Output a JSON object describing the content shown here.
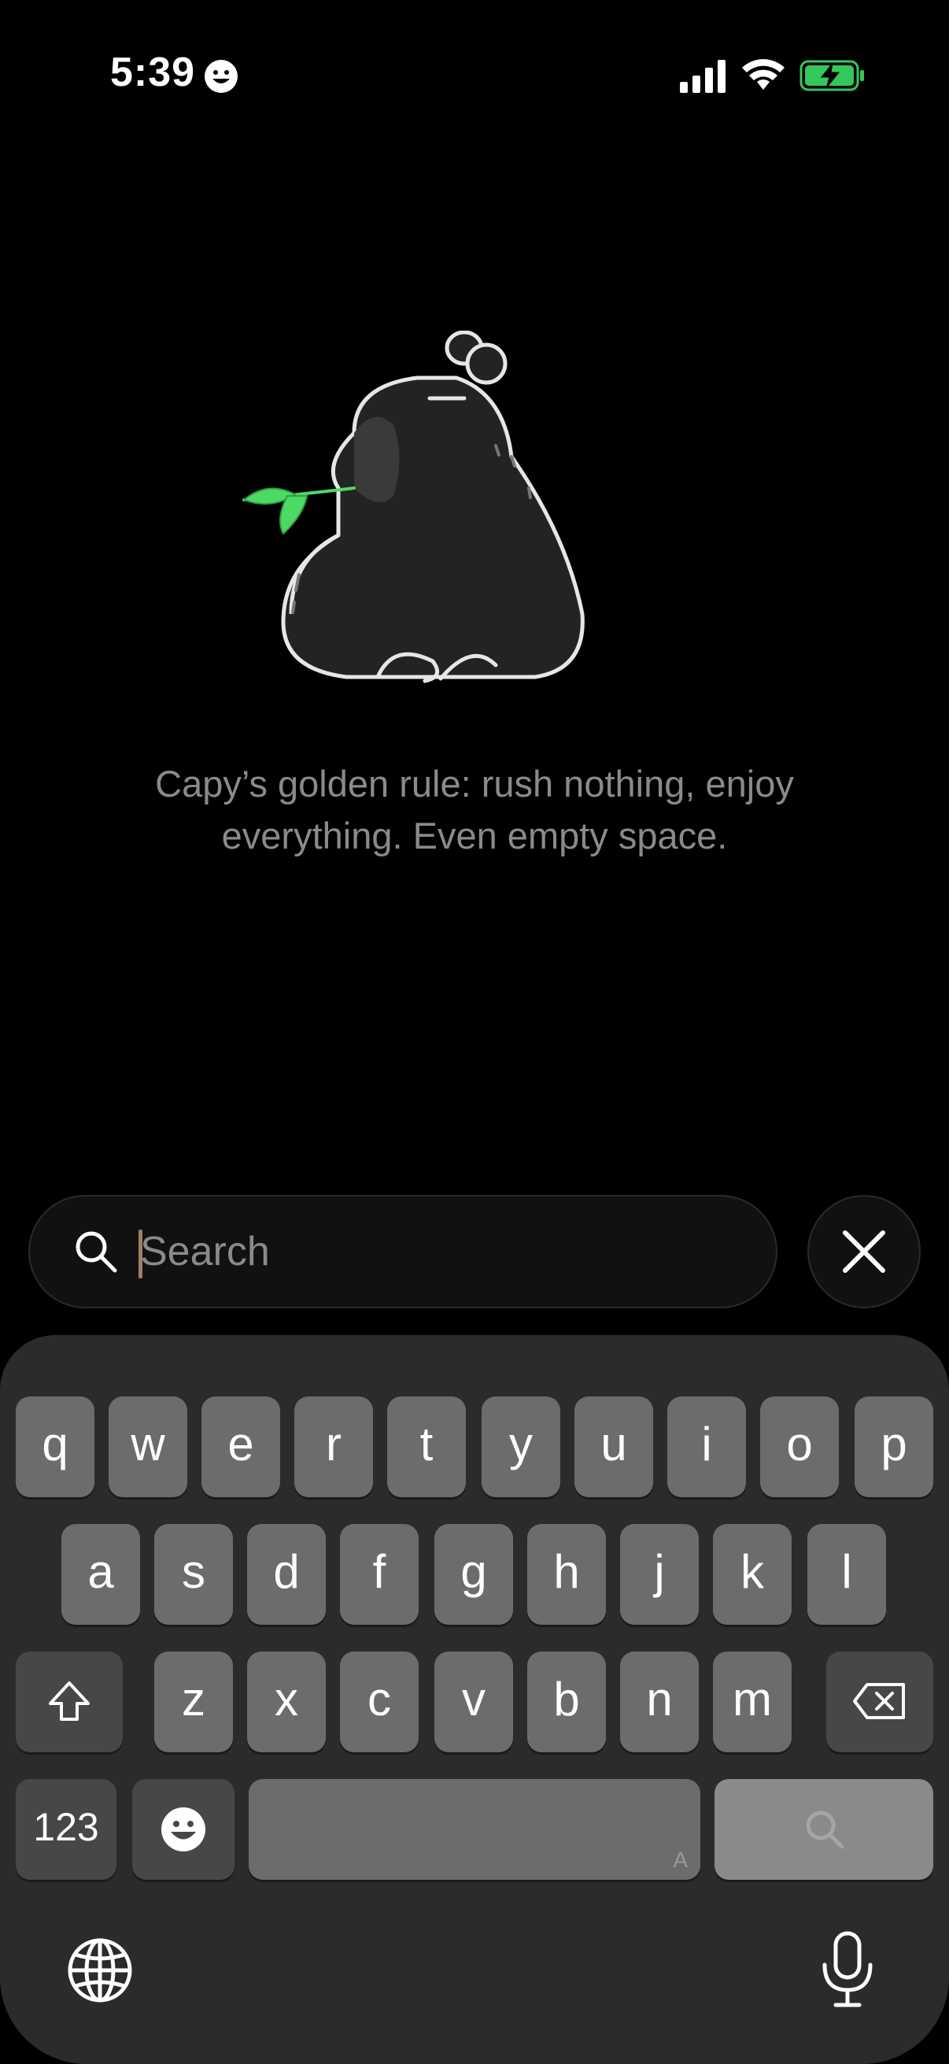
{
  "status_bar": {
    "time": "5:39",
    "battery_color": "#34c759"
  },
  "empty_state": {
    "message": "Capy’s golden rule: rush nothing, enjoy everything. Even empty space.",
    "illustration_icon": "capybara-with-leaf-illustration"
  },
  "search": {
    "placeholder": "Search",
    "value": ""
  },
  "keyboard": {
    "row1": [
      "q",
      "w",
      "e",
      "r",
      "t",
      "y",
      "u",
      "i",
      "o",
      "p"
    ],
    "row2": [
      "a",
      "s",
      "d",
      "f",
      "g",
      "h",
      "j",
      "k",
      "l"
    ],
    "row3": [
      "z",
      "x",
      "c",
      "v",
      "b",
      "n",
      "m"
    ],
    "numbers_label": "123",
    "space_hint": "A"
  },
  "colors": {
    "background": "#000000",
    "keyboard_bg": "#2b2b2b",
    "key": "#6c6c6c",
    "text_muted": "#8a8a8e",
    "leaf": "#4cd964"
  }
}
